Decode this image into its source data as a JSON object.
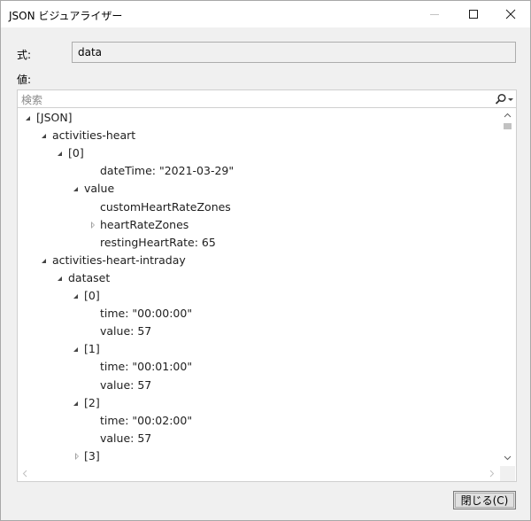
{
  "window": {
    "title": "JSON ビジュアライザー"
  },
  "expression": {
    "label": "式:",
    "value": "data"
  },
  "value_section": {
    "label": "値:"
  },
  "search": {
    "placeholder": "検索"
  },
  "tree": {
    "rows": [
      {
        "text": "[JSON]",
        "state": "expanded"
      },
      {
        "text": "activities-heart",
        "state": "expanded"
      },
      {
        "text": "[0]",
        "state": "expanded"
      },
      {
        "text": "dateTime: \"2021-03-29\"",
        "state": "leaf"
      },
      {
        "text": "value",
        "state": "expanded"
      },
      {
        "text": "customHeartRateZones",
        "state": "leaf"
      },
      {
        "text": "heartRateZones",
        "state": "collapsed"
      },
      {
        "text": "restingHeartRate: 65",
        "state": "leaf"
      },
      {
        "text": "activities-heart-intraday",
        "state": "expanded"
      },
      {
        "text": "dataset",
        "state": "expanded"
      },
      {
        "text": "[0]",
        "state": "expanded"
      },
      {
        "text": "time: \"00:00:00\"",
        "state": "leaf"
      },
      {
        "text": "value: 57",
        "state": "leaf"
      },
      {
        "text": "[1]",
        "state": "expanded"
      },
      {
        "text": "time: \"00:01:00\"",
        "state": "leaf"
      },
      {
        "text": "value: 57",
        "state": "leaf"
      },
      {
        "text": "[2]",
        "state": "expanded"
      },
      {
        "text": "time: \"00:02:00\"",
        "state": "leaf"
      },
      {
        "text": "value: 57",
        "state": "leaf"
      },
      {
        "text": "[3]",
        "state": "collapsed"
      }
    ]
  },
  "footer": {
    "close_label": "閉じる(C)"
  },
  "icons": {
    "minimize": "minimize-icon",
    "maximize": "maximize-icon",
    "close": "close-icon",
    "search": "search-icon",
    "dropdown": "chevron-down-icon"
  }
}
